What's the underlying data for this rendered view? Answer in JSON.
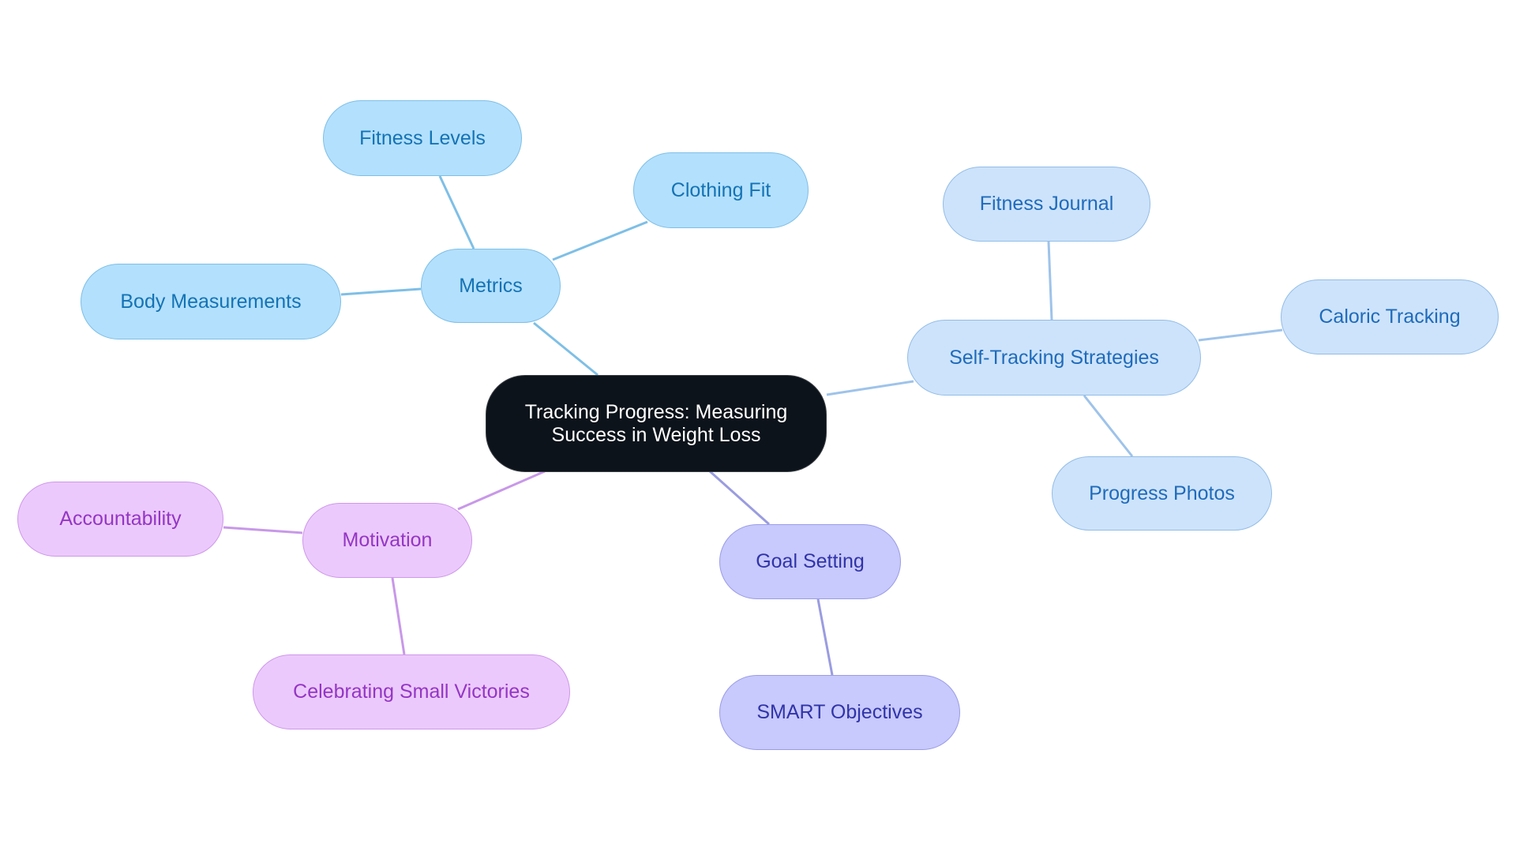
{
  "root": {
    "label_line1": "Tracking Progress: Measuring",
    "label_line2": "Success in Weight Loss"
  },
  "colors": {
    "metrics_edge": "#7ebfe6",
    "self_edge": "#9ec3ea",
    "goal_edge": "#9a9ce0",
    "motivation_edge": "#c898e8"
  },
  "branches": {
    "metrics": {
      "label": "Metrics",
      "children": [
        "Fitness Levels",
        "Clothing Fit",
        "Body Measurements"
      ]
    },
    "self_tracking": {
      "label": "Self-Tracking Strategies",
      "children": [
        "Fitness Journal",
        "Caloric Tracking",
        "Progress Photos"
      ]
    },
    "goal_setting": {
      "label": "Goal Setting",
      "children": [
        "SMART Objectives"
      ]
    },
    "motivation": {
      "label": "Motivation",
      "children": [
        "Accountability",
        "Celebrating Small Victories"
      ]
    }
  }
}
